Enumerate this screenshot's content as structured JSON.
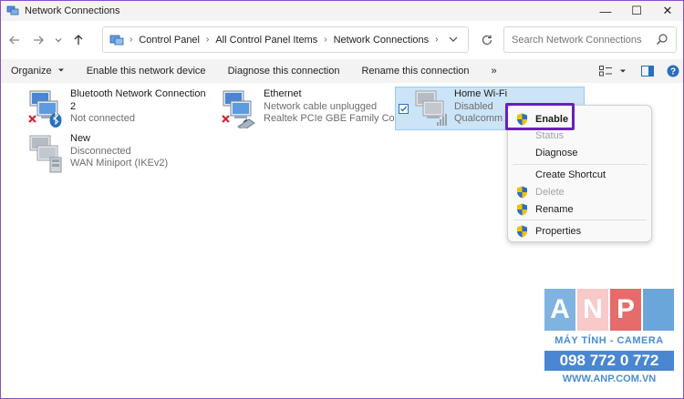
{
  "window": {
    "title": "Network Connections",
    "minimize_glyph": "—",
    "maximize_glyph": "☐",
    "close_glyph": "✕"
  },
  "address": {
    "breadcrumbs": [
      "Control Panel",
      "All Control Panel Items",
      "Network Connections"
    ],
    "search_placeholder": "Search Network Connections"
  },
  "toolbar": {
    "organize": "Organize",
    "enable": "Enable this network device",
    "diagnose": "Diagnose this connection",
    "rename": "Rename this connection",
    "more": "»"
  },
  "connections": [
    {
      "name_line1": "Bluetooth Network Connection",
      "name_line2": "2",
      "status": "Not connected",
      "icon": "bluetooth-network-icon"
    },
    {
      "name": "Ethernet",
      "status": "Network cable unplugged",
      "device": "Realtek PCIe GBE Family Contr...",
      "icon": "ethernet-network-icon"
    },
    {
      "name": "Home Wi-Fi",
      "status": "Disabled",
      "device": "Qualcomm A",
      "icon": "wifi-network-icon",
      "selected": true
    },
    {
      "name": "New",
      "status": "Disconnected",
      "device": "WAN Miniport (IKEv2)",
      "icon": "vpn-network-icon"
    }
  ],
  "context_menu": {
    "enable": "Enable",
    "status": "Status",
    "diagnose": "Diagnose",
    "create_shortcut": "Create Shortcut",
    "delete": "Delete",
    "rename": "Rename",
    "properties": "Properties"
  },
  "watermark": {
    "letters": [
      "A",
      "N",
      "P"
    ],
    "tagline": "MÁY TÍNH - CAMERA",
    "phone": "098 772 0 772",
    "url": "WWW.ANP.COM.VN"
  },
  "colors": {
    "highlight": "#6a1fbf",
    "selection": "#cce4f7",
    "shield_blue": "#2a6fc0",
    "shield_yellow": "#f2c200",
    "error_red": "#d8232a"
  }
}
